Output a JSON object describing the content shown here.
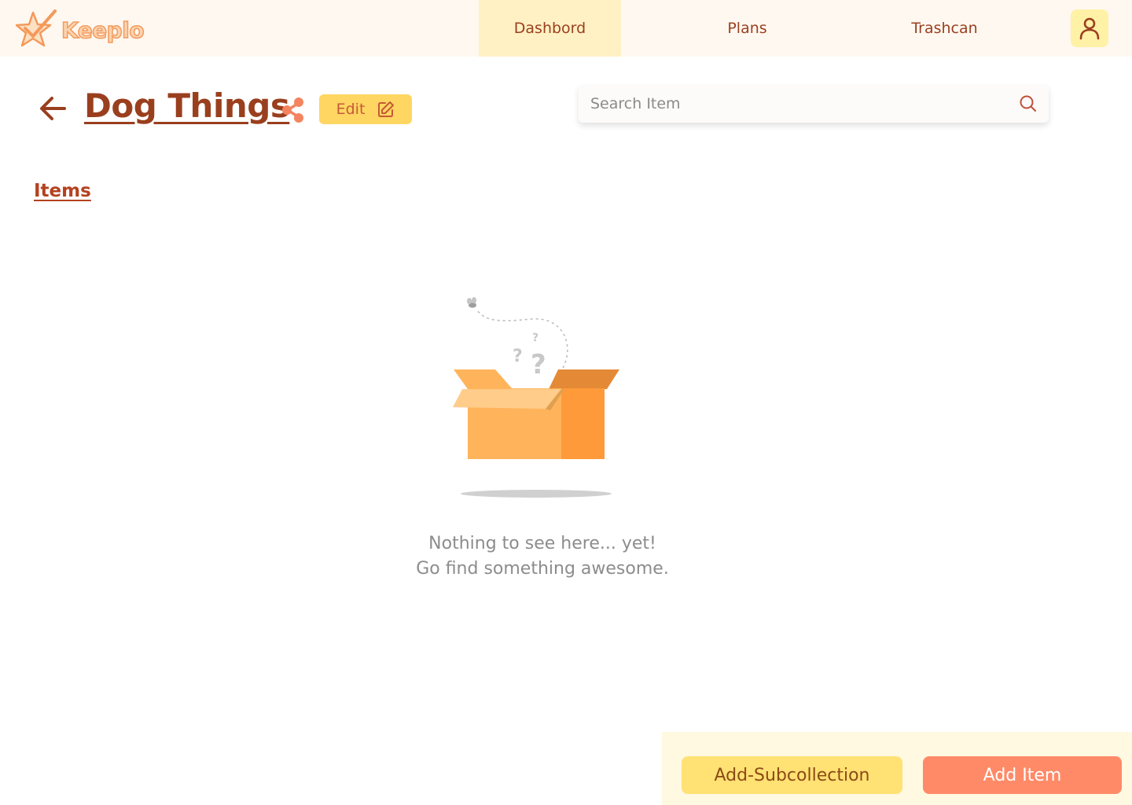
{
  "app": {
    "name": "Keeplo",
    "logo_icon": "star-check-icon"
  },
  "nav": {
    "tabs": [
      {
        "label": "Dashbord",
        "active": true
      },
      {
        "label": "Plans",
        "active": false
      },
      {
        "label": "Trashcan",
        "active": false
      }
    ],
    "profile_icon": "user-icon"
  },
  "header": {
    "back_icon": "arrow-left-icon",
    "title": "Dog Things",
    "share_icon": "share-icon",
    "edit_label": "Edit",
    "edit_icon": "edit-icon"
  },
  "search": {
    "placeholder": "Search Item",
    "value": "",
    "icon": "search-icon"
  },
  "section": {
    "items_label": "Items"
  },
  "empty_state": {
    "illustration": "empty-box-illustration",
    "line1": "Nothing to see here... yet!",
    "line2": "Go find something awesome."
  },
  "actions": {
    "add_subcollection_label": "Add-Subcollection",
    "add_item_label": "Add Item"
  },
  "colors": {
    "primary_text": "#9a3f1e",
    "accent_yellow": "#ffd662",
    "accent_orange": "#ff8a68",
    "topbar_bg": "#fff8f0",
    "active_tab_bg": "#fff1c4"
  }
}
